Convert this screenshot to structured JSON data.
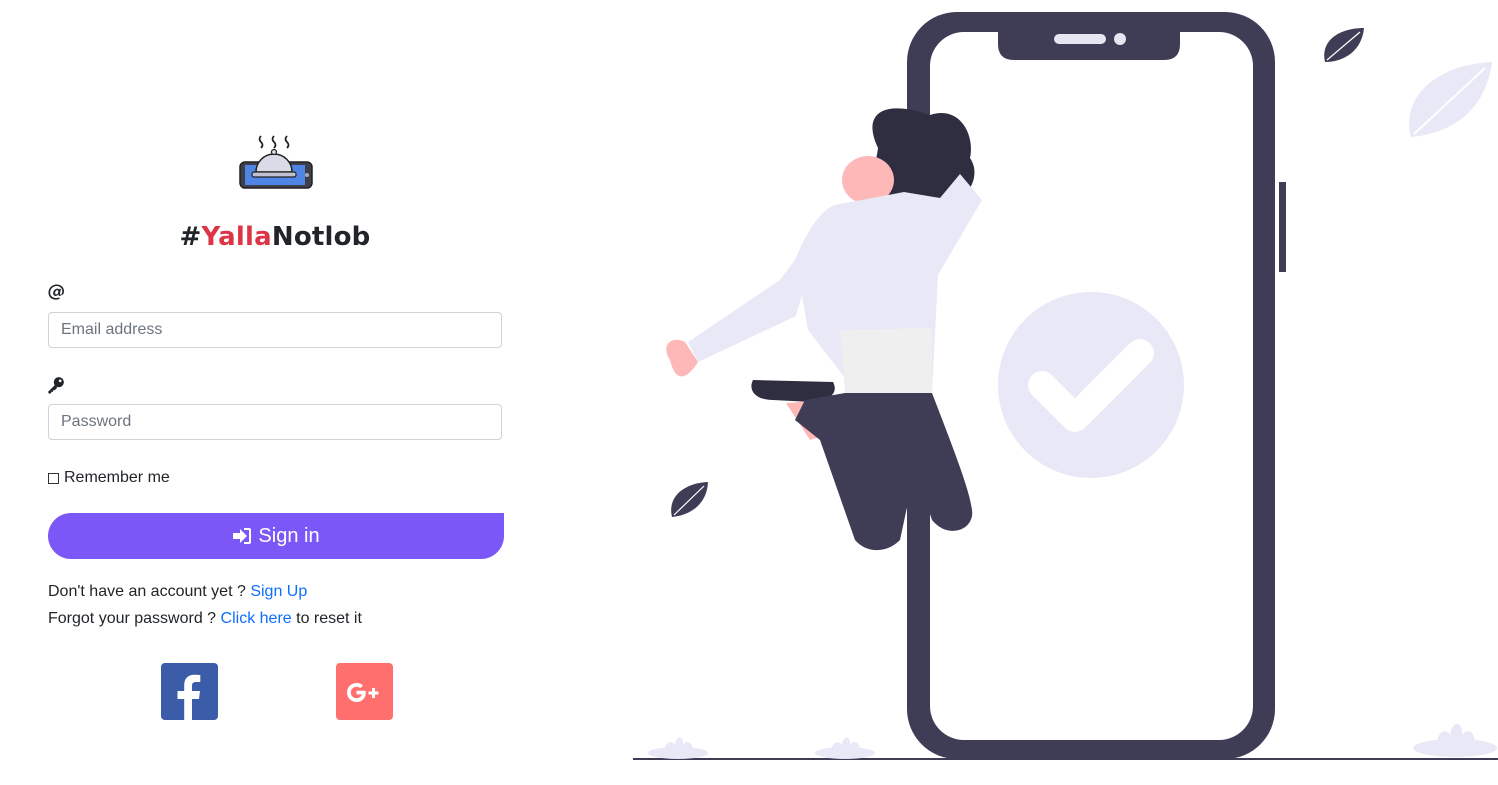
{
  "brand": {
    "prefix": "#",
    "highlight": "Yalla",
    "suffix": "Notlob"
  },
  "email": {
    "icon": "at-icon",
    "placeholder": "Email address"
  },
  "password": {
    "icon": "key-icon",
    "placeholder": "Password"
  },
  "remember": {
    "label": "Remember me",
    "checked": false
  },
  "signin": {
    "label": "Sign in",
    "icon": "sign-in-icon"
  },
  "signup_line": {
    "text": "Don't have an account yet ?",
    "link": "Sign Up"
  },
  "forgot_line": {
    "text": "Forgot your password ?",
    "link": "Click here",
    "suffix": "to reset it"
  },
  "social": {
    "facebook_icon": "facebook-icon",
    "google_icon": "google-plus-icon"
  },
  "colors": {
    "accent": "#7b57f8",
    "brand_red": "#dc3545",
    "facebook": "#3b5ca8",
    "google": "#fe6f6d",
    "link": "#0d6efd"
  }
}
